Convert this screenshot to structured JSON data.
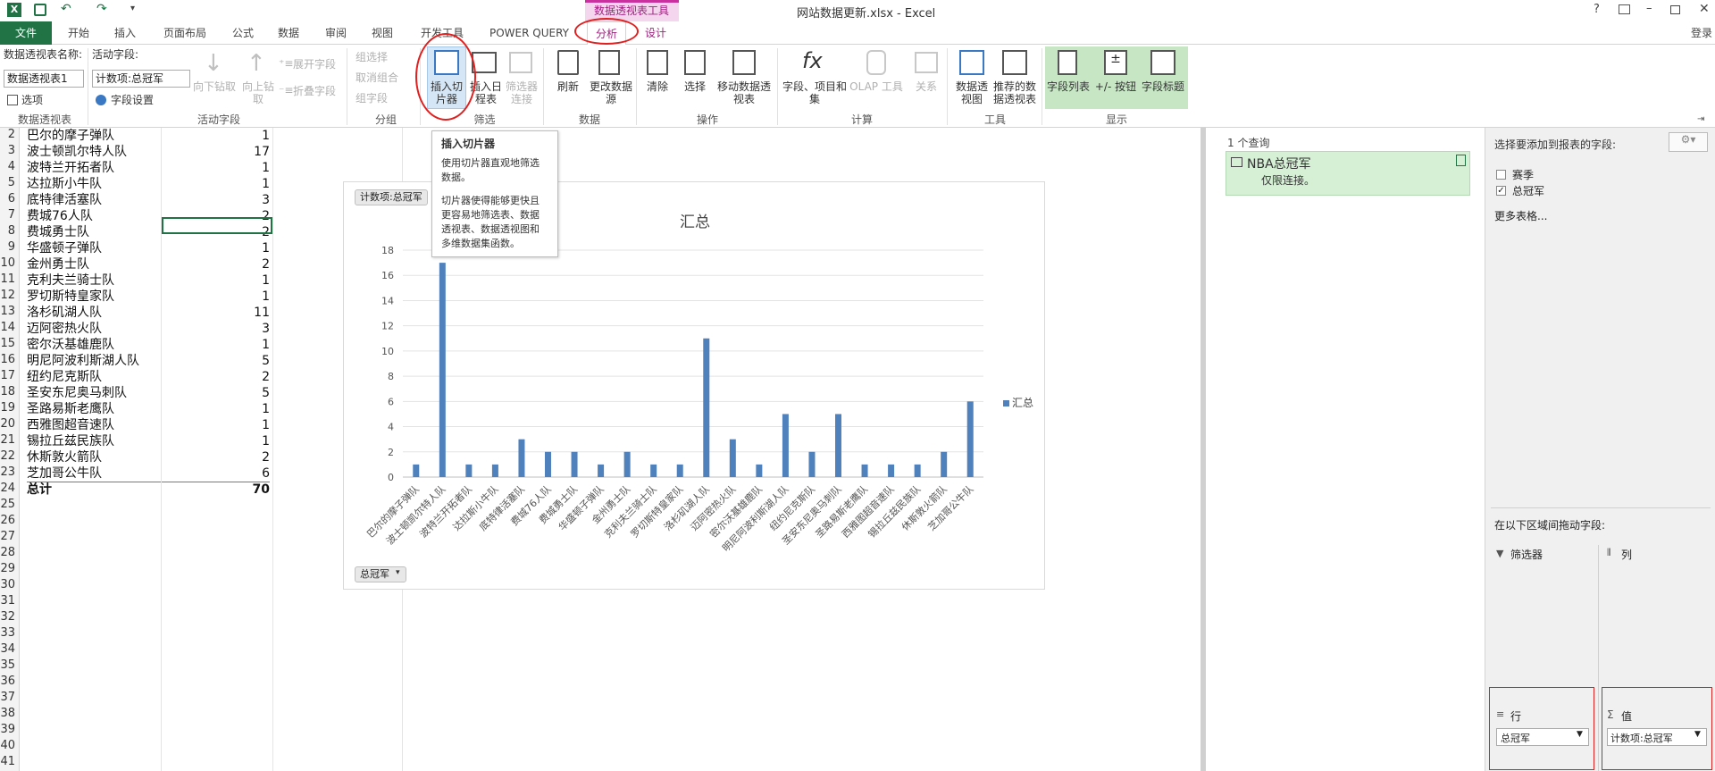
{
  "titlebar": {
    "file_title": "网站数据更新.xlsx - Excel",
    "context_tab_group": "数据透视表工具",
    "login": "登录",
    "help": "?"
  },
  "tabs": [
    "文件",
    "开始",
    "插入",
    "页面布局",
    "公式",
    "数据",
    "审阅",
    "视图",
    "开发工具",
    "POWER QUERY",
    "分析",
    "设计"
  ],
  "ribbon": {
    "pivot_name_label": "数据透视表名称:",
    "pivot_name_value": "数据透视表1",
    "options": "选项",
    "active_field_label": "活动字段:",
    "active_field_value": "计数项:总冠军",
    "field_settings": "字段设置",
    "drill_down": "向下钻取",
    "drill_up": "向上钻取",
    "expand_field": "展开字段",
    "collapse_field": "折叠字段",
    "group_selection": "组选择",
    "ungroup": "取消组合",
    "group_field": "组字段",
    "insert_slicer": "插入切片器",
    "insert_timeline": "插入日程表",
    "filter_connections": "筛选器连接",
    "refresh": "刷新",
    "change_source": "更改数据源",
    "clear": "清除",
    "select": "选择",
    "move_pivot": "移动数据透视表",
    "fields_items_sets": "字段、项目和集",
    "olap_tools": "OLAP 工具",
    "relationships": "关系",
    "pivot_chart": "数据透视图",
    "recommended": "推荐的数据透视表",
    "field_list": "字段列表",
    "buttons": "+/- 按钮",
    "field_headers": "字段标题",
    "groups": {
      "pivot": "数据透视表",
      "active": "活动字段",
      "group": "分组",
      "filter": "筛选",
      "data": "数据",
      "action": "操作",
      "calc": "计算",
      "tools": "工具",
      "show": "显示"
    }
  },
  "tooltip": {
    "title": "插入切片器",
    "line1": "使用切片器直观地筛选数据。",
    "line2": "切片器使得能够更快且更容易地筛选表、数据透视表、数据透视图和多维数据集函数。"
  },
  "rows": [
    {
      "n": "2",
      "team": "巴尔的摩子弹队",
      "count": "1"
    },
    {
      "n": "3",
      "team": "波士顿凯尔特人队",
      "count": "17"
    },
    {
      "n": "4",
      "team": "波特兰开拓者队",
      "count": "1"
    },
    {
      "n": "5",
      "team": "达拉斯小牛队",
      "count": "1"
    },
    {
      "n": "6",
      "team": "底特律活塞队",
      "count": "3"
    },
    {
      "n": "7",
      "team": "费城76人队",
      "count": "2"
    },
    {
      "n": "8",
      "team": "费城勇士队",
      "count": "2"
    },
    {
      "n": "9",
      "team": "华盛顿子弹队",
      "count": "1"
    },
    {
      "n": "10",
      "team": "金州勇士队",
      "count": "2"
    },
    {
      "n": "11",
      "team": "克利夫兰骑士队",
      "count": "1"
    },
    {
      "n": "12",
      "team": "罗切斯特皇家队",
      "count": "1"
    },
    {
      "n": "13",
      "team": "洛杉矶湖人队",
      "count": "11"
    },
    {
      "n": "14",
      "team": "迈阿密热火队",
      "count": "3"
    },
    {
      "n": "15",
      "team": "密尔沃基雄鹿队",
      "count": "1"
    },
    {
      "n": "16",
      "team": "明尼阿波利斯湖人队",
      "count": "5"
    },
    {
      "n": "17",
      "team": "纽约尼克斯队",
      "count": "2"
    },
    {
      "n": "18",
      "team": "圣安东尼奥马刺队",
      "count": "5"
    },
    {
      "n": "19",
      "team": "圣路易斯老鹰队",
      "count": "1"
    },
    {
      "n": "20",
      "team": "西雅图超音速队",
      "count": "1"
    },
    {
      "n": "21",
      "team": "锡拉丘兹民族队",
      "count": "1"
    },
    {
      "n": "22",
      "team": "休斯敦火箭队",
      "count": "2"
    },
    {
      "n": "23",
      "team": "芝加哥公牛队",
      "count": "6"
    },
    {
      "n": "24",
      "team": "总计",
      "count": "70"
    }
  ],
  "empty_rows": [
    "25",
    "26",
    "27",
    "28",
    "29",
    "30",
    "31",
    "32",
    "33",
    "34",
    "35",
    "36",
    "37",
    "38",
    "39",
    "40",
    "41"
  ],
  "chart_data": {
    "type": "bar",
    "title": "汇总",
    "legend": "汇总",
    "legend_position": "right",
    "value_button": "计数项:总冠军",
    "axis_button": "总冠军",
    "categories": [
      "巴尔的摩子弹队",
      "波士顿凯尔特人队",
      "波特兰开拓者队",
      "达拉斯小牛队",
      "底特律活塞队",
      "费城76人队",
      "费城勇士队",
      "华盛顿子弹队",
      "金州勇士队",
      "克利夫兰骑士队",
      "罗切斯特皇家队",
      "洛杉矶湖人队",
      "迈阿密热火队",
      "密尔沃基雄鹿队",
      "明尼阿波利斯湖人队",
      "纽约尼克斯队",
      "圣安东尼奥马刺队",
      "圣路易斯老鹰队",
      "西雅图超音速队",
      "锡拉丘兹民族队",
      "休斯敦火箭队",
      "芝加哥公牛队"
    ],
    "values": [
      1,
      17,
      1,
      1,
      3,
      2,
      2,
      1,
      2,
      1,
      1,
      11,
      3,
      1,
      5,
      2,
      5,
      1,
      1,
      1,
      2,
      6
    ],
    "ylim": [
      0,
      18
    ],
    "yticks": [
      "0",
      "2",
      "4",
      "6",
      "8",
      "10",
      "12",
      "14",
      "16",
      "18"
    ],
    "grid": true,
    "bar_color": "#4f81bd"
  },
  "queries": {
    "count": "1 个查询",
    "name": "NBA总冠军",
    "desc": "仅限连接。"
  },
  "fieldlist": {
    "header": "选择要添加到报表的字段:",
    "fields": [
      {
        "name": "赛季",
        "checked": false
      },
      {
        "name": "总冠军",
        "checked": true
      }
    ],
    "more": "更多表格...",
    "drag_label": "在以下区域间拖动字段:",
    "filters": "筛选器",
    "columns": "列",
    "rows": "行",
    "values": "值",
    "row_item": "总冠军",
    "value_item": "计数项:总冠军"
  },
  "accent": "#217346",
  "highlight": "#e02020"
}
